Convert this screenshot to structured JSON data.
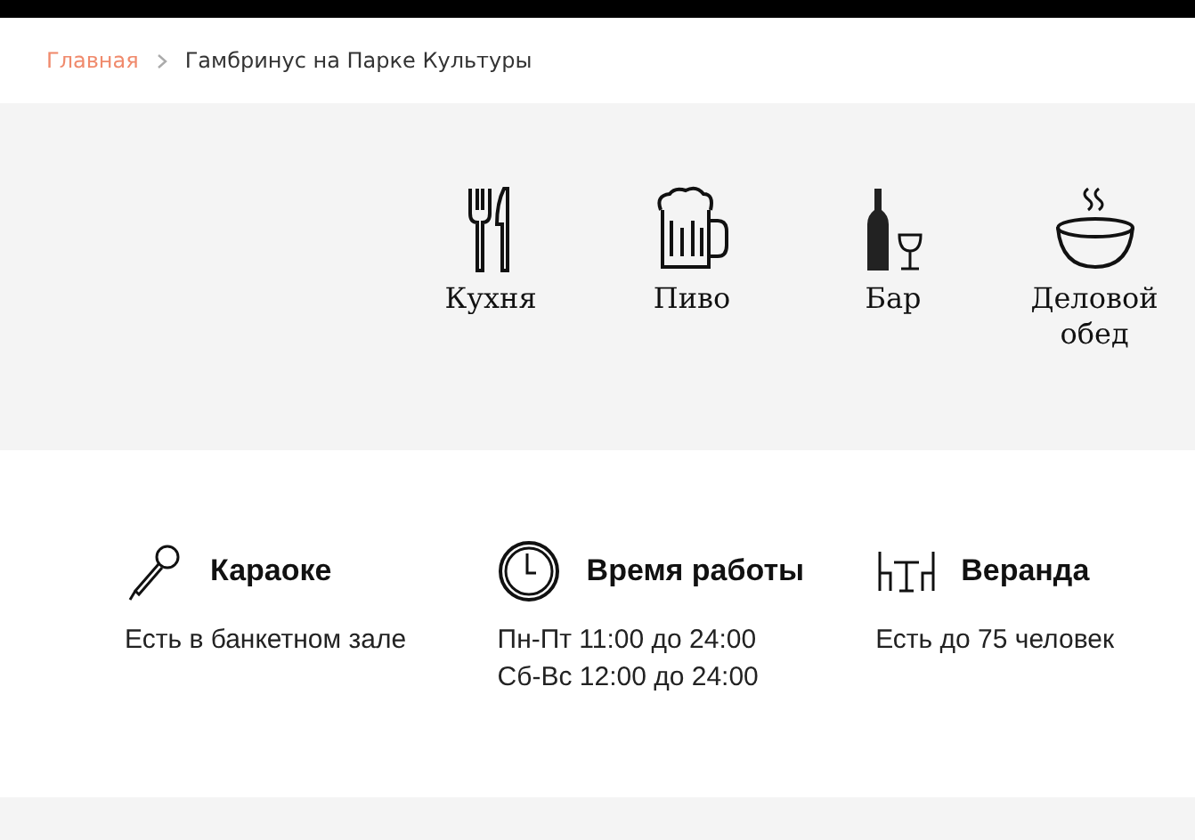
{
  "breadcrumbs": [
    {
      "label": "Главная",
      "kind": "link"
    },
    {
      "label": "Гамбринус на Парке Культуры",
      "kind": "current"
    }
  ],
  "categories": [
    {
      "label": "Кухня",
      "kind": "cutlery"
    },
    {
      "label": "Пиво",
      "kind": "beer"
    },
    {
      "label": "Бар",
      "kind": "wine"
    },
    {
      "label": "Деловой обед",
      "kind": "bowl"
    }
  ],
  "features": [
    {
      "title": "Караоке",
      "kind": "microphone",
      "lines": [
        "Есть в банкетном зале"
      ]
    },
    {
      "title": "Время работы",
      "kind": "clock",
      "lines": [
        "Пн-Пт 11:00 до 24:00",
        "Сб-Вс 12:00 до 24:00"
      ]
    },
    {
      "title": "Веранда",
      "kind": "table",
      "lines": [
        "Есть до 75 человек"
      ]
    }
  ]
}
